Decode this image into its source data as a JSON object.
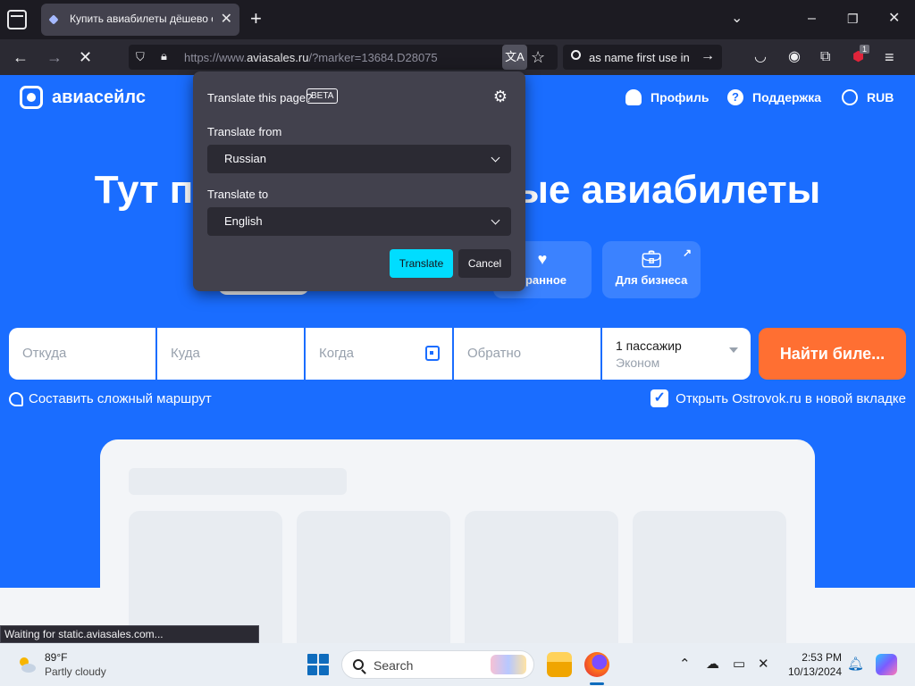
{
  "browser": {
    "tab_title": "Купить авиабилеты дёшево онлайн",
    "url_base": "https://www.",
    "url_host": "aviasales.ru",
    "url_path": "/?marker=13684.D28075",
    "search_query": "as name first use in",
    "status_text": "Waiting for static.aviasales.com...",
    "extension_badge": "1"
  },
  "site": {
    "logo": "авиасейлс",
    "header_links": {
      "profile": "Профиль",
      "support": "Поддержка",
      "currency": "RUB"
    },
    "hero_left": "Тут п",
    "hero_right": "ые авиабилеты",
    "category_cards": {
      "favorites": "бранное",
      "business": "Для бизнеса"
    },
    "search_form": {
      "from_placeholder": "Откуда",
      "to_placeholder": "Куда",
      "date_placeholder": "Когда",
      "return_placeholder": "Обратно",
      "passengers": "1 пассажир",
      "class": "Эконом",
      "find_button": "Найти биле..."
    },
    "complex_route": "Составить сложный маршрут",
    "ostrovok_checkbox": "Открыть Ostrovok.ru в новой вкладке"
  },
  "translate_popup": {
    "title": "Translate this page?",
    "badge": "BETA",
    "from_label": "Translate from",
    "from_value": "Russian",
    "to_label": "Translate to",
    "to_value": "English",
    "translate_button": "Translate",
    "cancel_button": "Cancel"
  },
  "taskbar": {
    "weather_temp": "89°F",
    "weather_desc": "Partly cloudy",
    "search_label": "Search",
    "time": "2:53 PM",
    "date": "10/13/2024"
  },
  "colors": {
    "page_blue": "#1a6dff",
    "find_orange": "#ff6f32",
    "translate_cyan": "#00ddff"
  }
}
